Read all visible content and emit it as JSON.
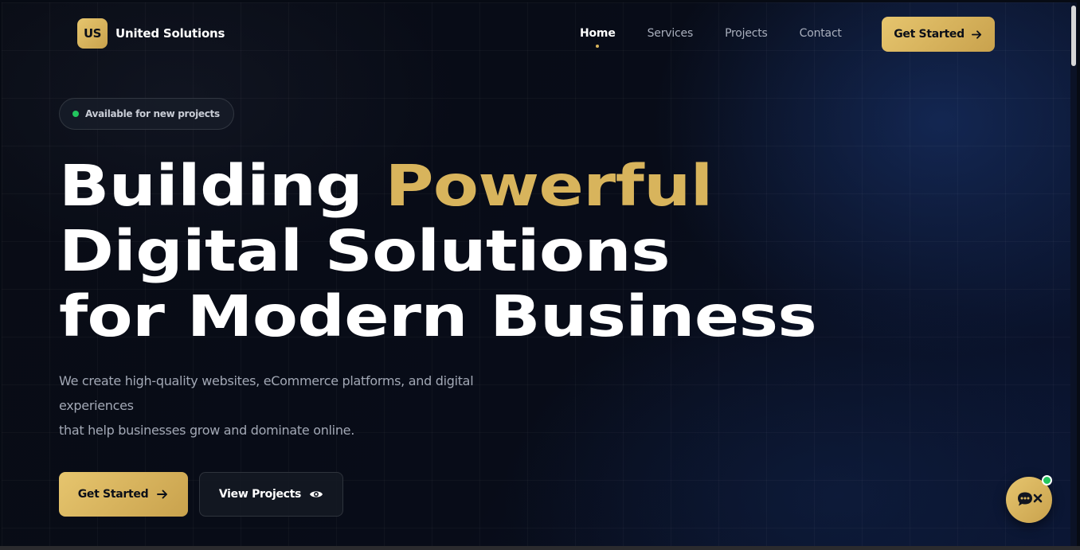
{
  "brand": {
    "logo_initials": "US",
    "name": "United Solutions"
  },
  "nav": {
    "items": [
      {
        "label": "Home",
        "active": true
      },
      {
        "label": "Services",
        "active": false
      },
      {
        "label": "Projects",
        "active": false
      },
      {
        "label": "Contact",
        "active": false
      }
    ],
    "cta_label": "Get Started",
    "cta_icon": "arrow-right-icon"
  },
  "hero": {
    "badge_text": "Available for new projects",
    "headline": {
      "line1_prefix": "Building ",
      "line1_accent": "Powerful",
      "line2": "Digital Solutions",
      "line3": "for Modern Business"
    },
    "subtext": {
      "line1": "We create high-quality websites, eCommerce platforms, and digital",
      "line2": "experiences",
      "line3": "that help businesses grow and dominate online."
    },
    "primary_button": {
      "label": "Get Started",
      "icon": "arrow-right-icon"
    },
    "secondary_button": {
      "label": "View Projects",
      "icon": "eye-icon"
    }
  },
  "chat_widget": {
    "icon": "chat-close-icon",
    "status": "online"
  },
  "colors": {
    "background": "#080c18",
    "accent_gold": "#d8b45c",
    "status_green": "#22c55e",
    "text_primary": "#ffffff",
    "text_muted": "#a2a8b5"
  }
}
